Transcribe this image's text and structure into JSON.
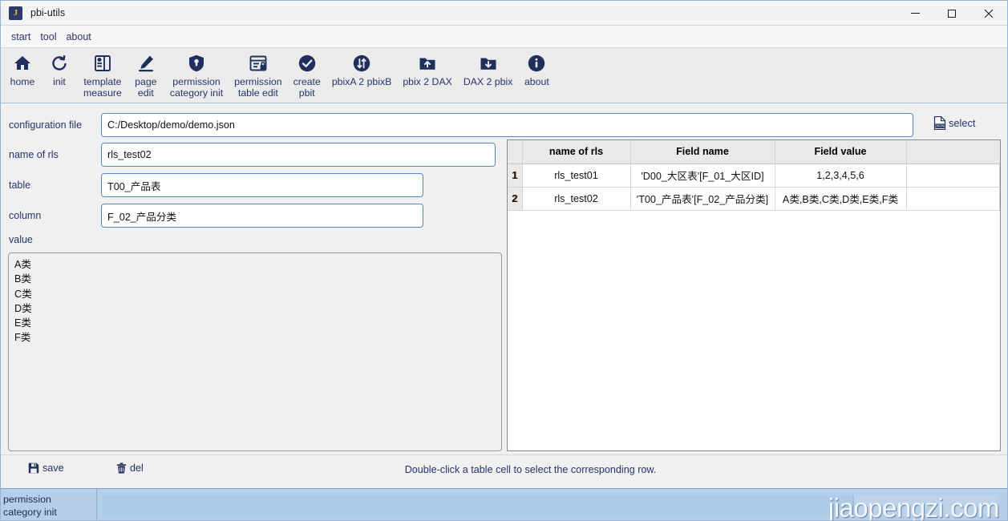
{
  "window": {
    "title": "pbi-utils",
    "icon_letter": "J",
    "controls": {
      "minimize": "minimize-icon",
      "maximize": "maximize-icon",
      "close": "close-icon"
    }
  },
  "menubar": {
    "items": [
      {
        "label": "start"
      },
      {
        "label": "tool"
      },
      {
        "label": "about"
      }
    ]
  },
  "toolbar": {
    "items": [
      {
        "label": "home",
        "icon": "home-icon"
      },
      {
        "label": "init",
        "icon": "refresh-icon"
      },
      {
        "label": "template\nmeasure",
        "icon": "template-icon"
      },
      {
        "label": "page\nedit",
        "icon": "pencil-icon"
      },
      {
        "label": "permission\ncategory init",
        "icon": "shield-icon"
      },
      {
        "label": "permission\ntable edit",
        "icon": "table-lock-icon"
      },
      {
        "label": "create\npbit",
        "icon": "check-circle-icon"
      },
      {
        "label": "pbixA 2 pbixB",
        "icon": "transfer-icon"
      },
      {
        "label": "pbix 2 DAX",
        "icon": "folder-up-icon"
      },
      {
        "label": "DAX 2 pbix",
        "icon": "folder-down-icon"
      },
      {
        "label": "about",
        "icon": "info-icon"
      }
    ]
  },
  "form": {
    "config_file": {
      "label": "configuration file",
      "value": "C:/Desktop/demo/demo.json",
      "placeholder": ""
    },
    "select_button": {
      "label": "select",
      "icon": "json-file-icon"
    },
    "name_of_rls": {
      "label": "name of rls",
      "value": "rls_test02",
      "placeholder": ""
    },
    "table": {
      "label": "table",
      "value": "T00_产品表",
      "placeholder": ""
    },
    "column": {
      "label": "column",
      "value": "F_02_产品分类",
      "placeholder": ""
    },
    "value": {
      "label": "value",
      "text": "A类\nB类\nC类\nD类\nE类\nF类",
      "placeholder": ""
    }
  },
  "table_panel": {
    "columns": [
      "",
      "name of rls",
      "Field name",
      "Field value",
      ""
    ],
    "rows": [
      {
        "index": "1",
        "name_of_rls": "rls_test01",
        "field_name": "'D00_大区表'[F_01_大区ID]",
        "field_value": "1,2,3,4,5,6"
      },
      {
        "index": "2",
        "name_of_rls": "rls_test02",
        "field_name": "'T00_产品表'[F_02_产品分类]",
        "field_value": "A类,B类,C类,D类,E类,F类"
      }
    ]
  },
  "actionbar": {
    "save": {
      "label": "save",
      "icon": "floppy-save-icon"
    },
    "del": {
      "label": "del",
      "icon": "trash-icon"
    },
    "hint": "Double-click a table cell to select the corresponding row."
  },
  "statusbar": {
    "label": "permission\ncategory init",
    "progress_percent": 84,
    "watermark": "jiaopengzi.com"
  },
  "colors": {
    "accent": "#23356b",
    "icon": "#1f2f5e",
    "input_border": "#5b86c4",
    "toolbar_bg": "#ebebeb",
    "status_bg": "#b6cfe8"
  }
}
